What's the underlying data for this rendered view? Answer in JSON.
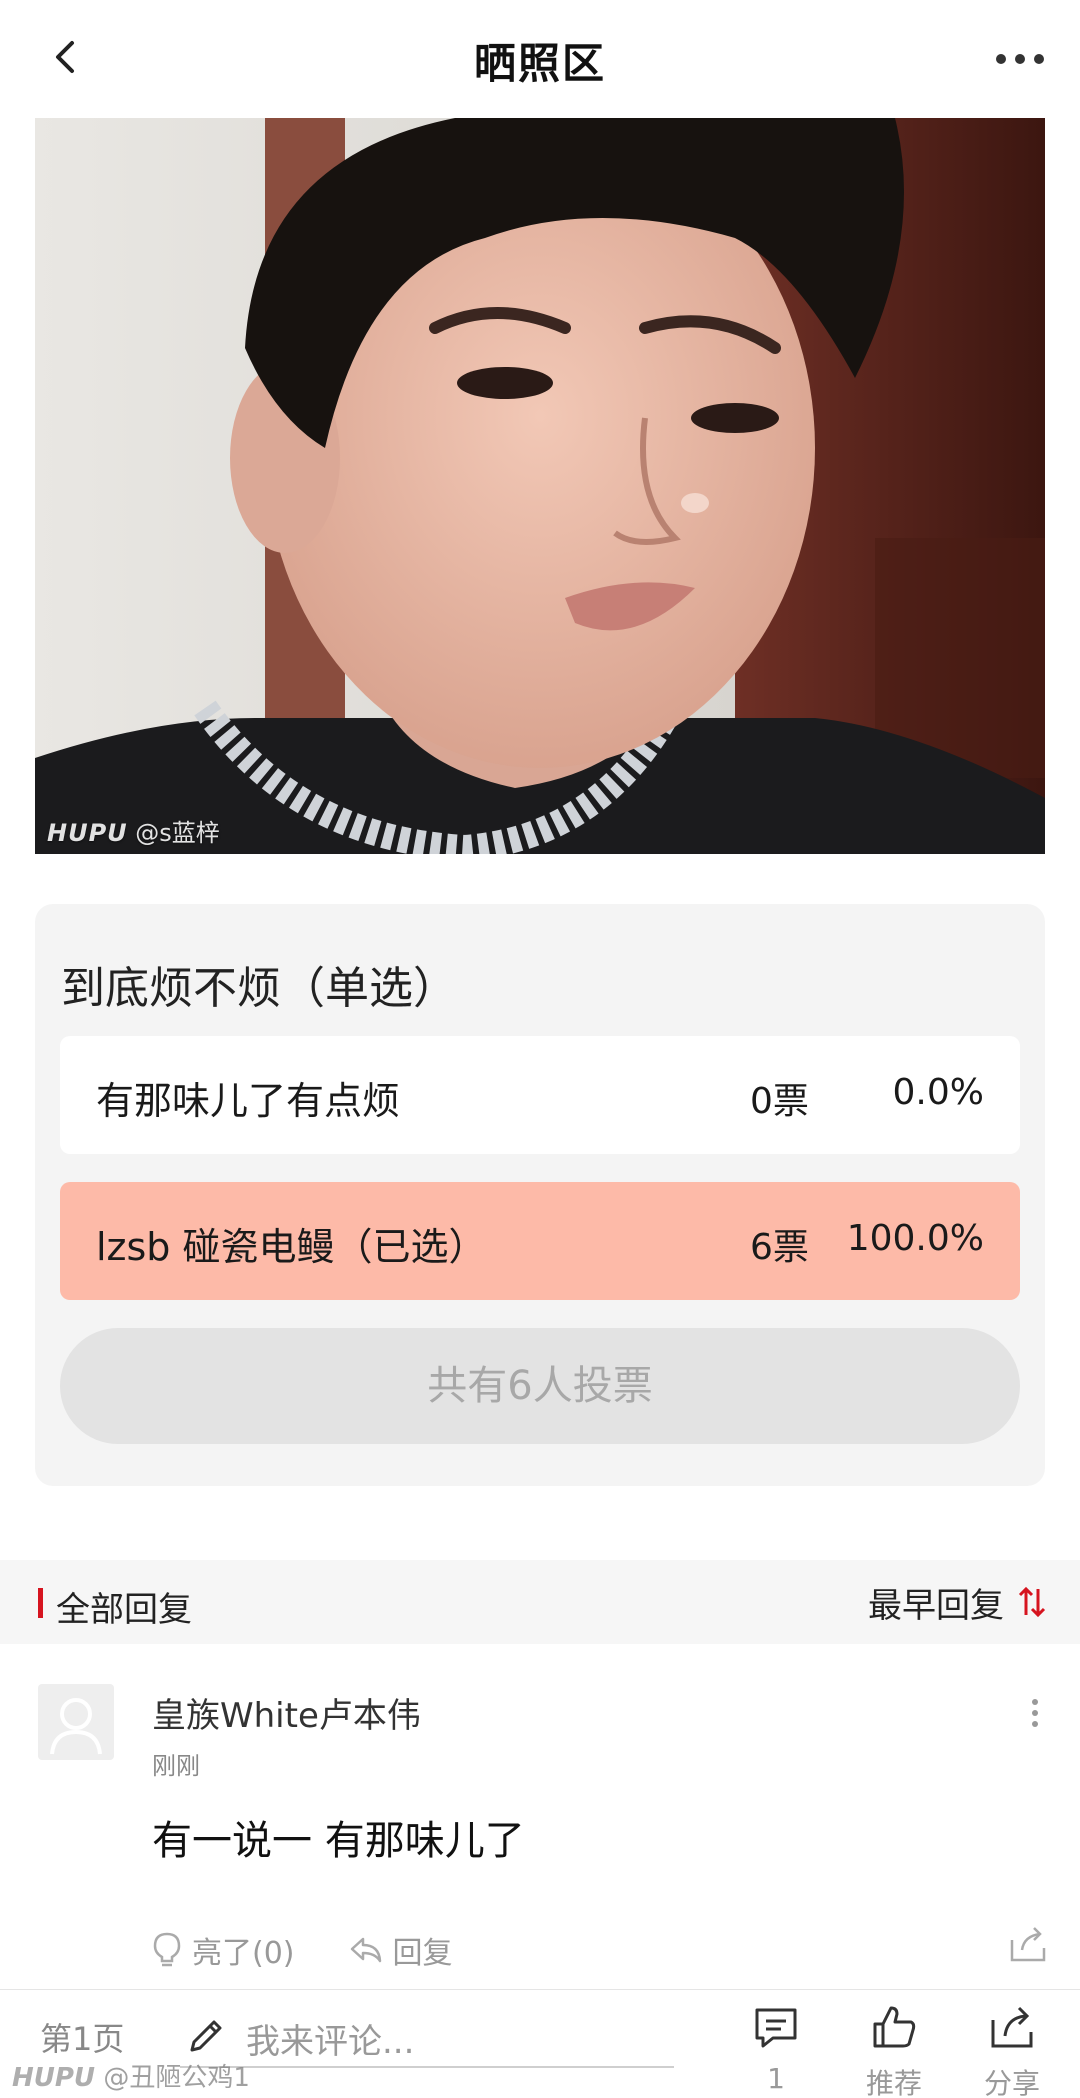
{
  "header": {
    "title": "晒照区"
  },
  "photo": {
    "watermark_brand": "HUPU",
    "watermark_user": "@s蓝梓"
  },
  "poll": {
    "title": "到底烦不烦（单选）",
    "options": [
      {
        "label": "有那味儿了有点烦",
        "votes": "0票",
        "percent": "0.0%",
        "selected": false,
        "fraction": 0.0
      },
      {
        "label": "lzsb 碰瓷电鳗（已选）",
        "votes": "6票",
        "percent": "100.0%",
        "selected": true,
        "fraction": 1.0
      }
    ],
    "total": "共有6人投票"
  },
  "replies": {
    "section_label": "全部回复",
    "sort_label": "最早回复"
  },
  "comment": {
    "username": "皇族White卢本伟",
    "time": "刚刚",
    "text": "有一说一 有那味儿了",
    "light_label": "亮了(0)",
    "reply_label": "回复"
  },
  "bottom_bar": {
    "page_label": "第1页",
    "input_placeholder": "我来评论...",
    "comment_count": "1",
    "recommend_label": "推荐",
    "share_label": "分享",
    "watermark_brand": "HUPU",
    "watermark_user": "@丑陋公鸡1"
  },
  "colors": {
    "accent_red": "#d6141f",
    "selected_option_bg": "#fdbaa8",
    "poll_bg": "#f4f4f4"
  },
  "icons": [
    "chevron-left-icon",
    "more-horizontal-icon",
    "sort-icon",
    "more-vertical-icon",
    "lightbulb-icon",
    "reply-arrow-icon",
    "share-icon",
    "pencil-icon",
    "comment-icon",
    "thumb-up-icon"
  ]
}
